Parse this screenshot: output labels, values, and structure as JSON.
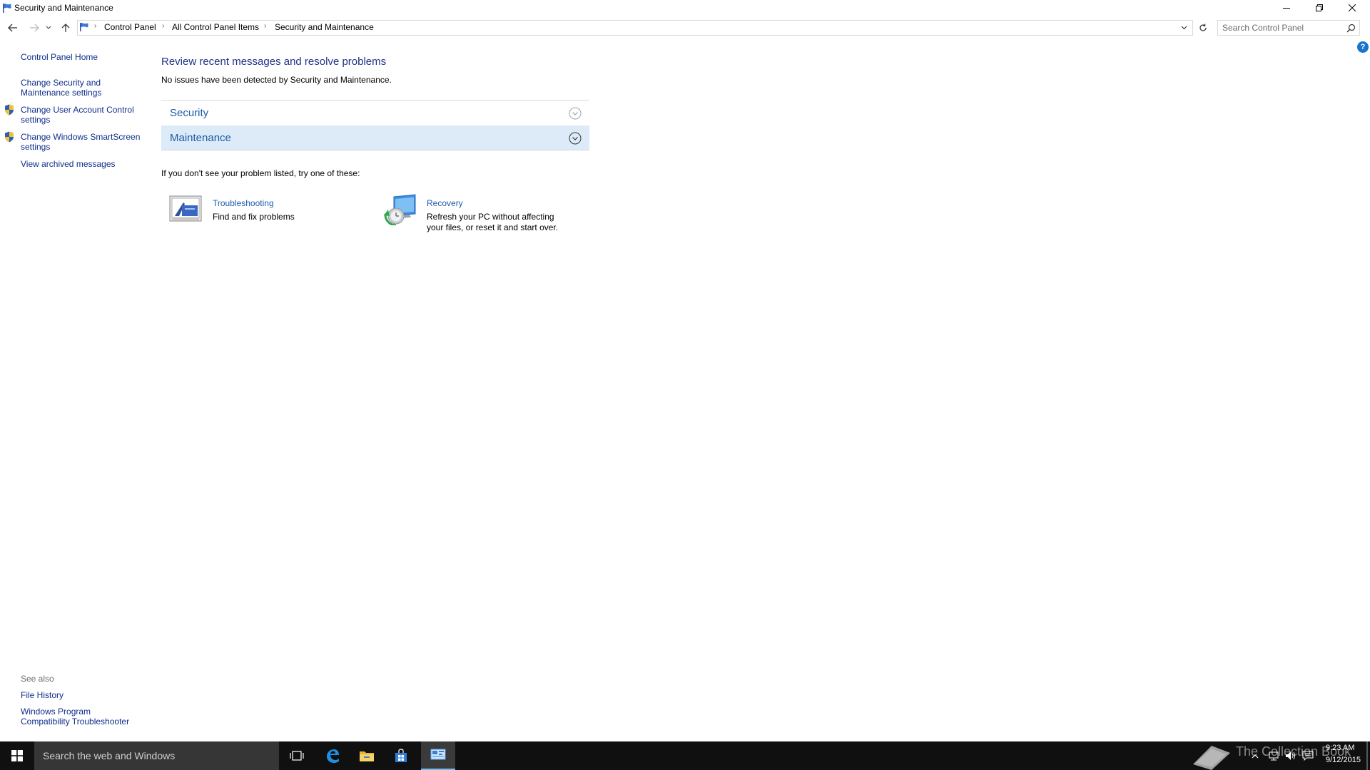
{
  "window": {
    "title": "Security and Maintenance"
  },
  "address": {
    "breadcrumbs": [
      "Control Panel",
      "All Control Panel Items",
      "Security and Maintenance"
    ]
  },
  "search": {
    "placeholder": "Search Control Panel"
  },
  "help": {
    "label": "?"
  },
  "left_pane": {
    "home": "Control Panel Home",
    "links": [
      {
        "line1": "Change Security and",
        "line2": "Maintenance settings",
        "icon": "none"
      },
      {
        "line1": "Change User Account Control",
        "line2": "settings",
        "icon": "shield-icon"
      },
      {
        "line1": "Change Windows SmartScreen",
        "line2": "settings",
        "icon": "shield-icon"
      }
    ],
    "archived": "View archived messages",
    "see_also": {
      "label": "See also",
      "file_history": "File History",
      "compat_line1": "Windows Program",
      "compat_line2": "Compatibility Troubleshooter"
    }
  },
  "main": {
    "heading": "Review recent messages and resolve problems",
    "subtext": "No issues have been detected by Security and Maintenance.",
    "sections": [
      {
        "title": "Security",
        "expanded": false
      },
      {
        "title": "Maintenance",
        "expanded": false,
        "highlighted": true
      }
    ],
    "try_text": "If you don't see your problem listed, try one of these:",
    "tools": [
      {
        "title": "Troubleshooting",
        "desc_line1": "Find and fix problems",
        "desc_line2": "",
        "icon": "troubleshooting-icon"
      },
      {
        "title": "Recovery",
        "desc_line1": "Refresh your PC without affecting",
        "desc_line2": "your files, or reset it and start over.",
        "icon": "recovery-icon"
      }
    ]
  },
  "taskbar": {
    "search_text": "Search the web and Windows",
    "apps": [
      "task-view-icon",
      "edge-icon",
      "file-explorer-icon",
      "store-icon",
      "control-panel-icon"
    ],
    "watermark": "The Collection Book",
    "time": "9:23 AM",
    "date": "9/12/2015"
  },
  "colors": {
    "link": "#0f2e8a",
    "heading": "#1e3287",
    "section_title": "#1e5aa8",
    "section_highlight": "#dcebf7",
    "taskbar": "#101010",
    "taskbar_search": "#363636"
  }
}
